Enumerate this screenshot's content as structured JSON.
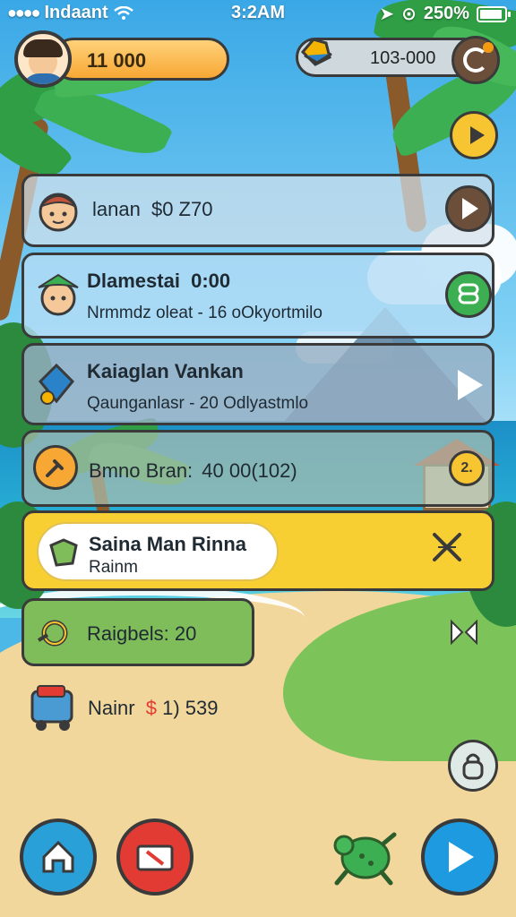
{
  "status_bar": {
    "carrier": "Indaant",
    "time": "3:2AM",
    "battery": "250%"
  },
  "hud": {
    "coins": "11 000",
    "gems": "103-000",
    "gem_icon": "gem-bag-icon",
    "timer_icon": "timer-icon"
  },
  "cards": [
    {
      "title": "lanan",
      "amount": "$0 Z70",
      "action_icon": "play-icon"
    },
    {
      "title": "Dlamestai",
      "amount": "0:00",
      "subtitle": "Nrmmdz oleat - 16 oOkyortmilo",
      "action_icon": "cash-icon"
    },
    {
      "title": "Kaiaglan Vankan",
      "subtitle": "Qaunganlasr - 20 Odlyastmlo",
      "action_icon": "play-icon"
    },
    {
      "title": "Bmno Bran:",
      "amount": "40 00(102)",
      "badge": "2."
    },
    {
      "title": "Saina Man Rinna",
      "subtitle": "Rainm",
      "action_icon": "close-x-icon"
    },
    {
      "title": "Raigbels: 20",
      "action_icon": "next-icon"
    }
  ],
  "bottom_item": {
    "label": "Nainr",
    "currency": "$",
    "value": "1) 539"
  },
  "colors": {
    "accent_yellow": "#f7cf33",
    "accent_green": "#7ebd5a",
    "accent_blue": "#1e9ae0",
    "accent_red": "#e23b34",
    "outline": "#3a3a3a"
  },
  "nav": [
    "home-icon",
    "video-icon",
    "turtle-icon",
    "play-icon"
  ]
}
